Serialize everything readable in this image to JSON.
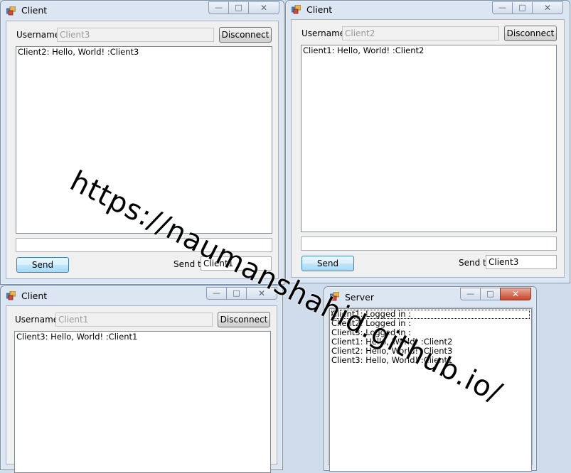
{
  "clients": [
    {
      "title": "Client",
      "username_label": "Username",
      "username_value": "Client3",
      "disconnect_label": "Disconnect",
      "messages": [
        "Client2: Hello, World! :Client3"
      ],
      "message_input": "",
      "send_label": "Send",
      "send_to_label": "Send to",
      "send_to_value": "Client1"
    },
    {
      "title": "Client",
      "username_label": "Username",
      "username_value": "Client2",
      "disconnect_label": "Disconnect",
      "messages": [
        "Client1: Hello, World! :Client2"
      ],
      "message_input": "",
      "send_label": "Send",
      "send_to_label": "Send to",
      "send_to_value": "Client3"
    },
    {
      "title": "Client",
      "username_label": "Username",
      "username_value": "Client1",
      "disconnect_label": "Disconnect",
      "messages": [
        "Client3: Hello, World! :Client1"
      ]
    }
  ],
  "server": {
    "title": "Server",
    "log": [
      "Client1: Logged in :",
      "Client2: Logged in :",
      "Client3: Logged in :",
      "Client1: Hello, World! :Client2",
      "Client2: Hello, World! :Client3",
      "Client3: Hello, World! :Client1"
    ]
  },
  "window_icons": {
    "minimize": "minimize-icon",
    "maximize": "maximize-icon",
    "close": "close-icon",
    "app": "windows-forms-icon"
  },
  "colors": {
    "close_active": "#c9452b",
    "desktop": "#cfdcec",
    "frame": "#dce6f2"
  },
  "watermark": "https://naumanshahid.github.io/"
}
